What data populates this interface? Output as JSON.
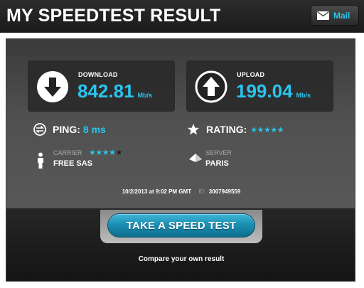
{
  "header": {
    "title": "MY SPEEDTEST RESULT",
    "mail_label": "Mail"
  },
  "download": {
    "label": "DOWNLOAD",
    "value": "842.81",
    "unit": "Mb/s",
    "icon": "arrow-down-icon"
  },
  "upload": {
    "label": "UPLOAD",
    "value": "199.04",
    "unit": "Mb/s",
    "icon": "arrow-up-icon"
  },
  "ping": {
    "label": "PING:",
    "value": "8 ms",
    "icon": "ping-icon"
  },
  "rating": {
    "label": "RATING:",
    "stars": "★★★★★",
    "stars_filled": 5,
    "stars_total": 5,
    "icon": "star-icon"
  },
  "carrier": {
    "label": "CARRIER",
    "value": "FREE SAS",
    "stars_filled_text": "★★★★",
    "stars_empty_text": "★",
    "stars_filled": 4,
    "stars_total": 5,
    "icon": "person-icon"
  },
  "server": {
    "label": "SERVER",
    "value": "PARIS",
    "icon": "server-icon"
  },
  "meta": {
    "date": "10/2/2013 at 9:02 PM GMT",
    "id_label": "ID:",
    "id": "3007949559"
  },
  "actions": {
    "speed_test_label": "TAKE A SPEED TEST",
    "compare_text": "Compare your own result"
  },
  "colors": {
    "accent": "#29c5ef",
    "background": "#1b1b1b",
    "button": "#1b8fb3"
  }
}
